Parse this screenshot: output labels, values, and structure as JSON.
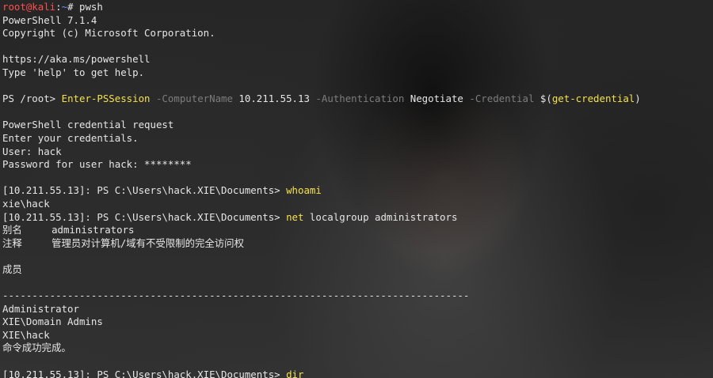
{
  "colors": {
    "text": "#e6e6e6",
    "prompt_user": "#ff4f4f",
    "prompt_path": "#6e8cff",
    "command": "#f5e14f",
    "parameter": "#7d7d7d"
  },
  "terminal": {
    "lines": [
      [
        {
          "t": "root@kali",
          "c": "red"
        },
        {
          "t": ":",
          "c": "white"
        },
        {
          "t": "~",
          "c": "blue"
        },
        {
          "t": "# pwsh",
          "c": "white"
        }
      ],
      [
        {
          "t": "PowerShell 7.1.4",
          "c": "white"
        }
      ],
      [
        {
          "t": "Copyright (c) Microsoft Corporation.",
          "c": "white"
        }
      ],
      [],
      [
        {
          "t": "https://aka.ms/powershell",
          "c": "white"
        }
      ],
      [
        {
          "t": "Type 'help' to get help.",
          "c": "white"
        }
      ],
      [],
      [
        {
          "t": "PS /root> ",
          "c": "white"
        },
        {
          "t": "Enter-PSSession",
          "c": "yellow"
        },
        {
          "t": " -ComputerName",
          "c": "dim"
        },
        {
          "t": " 10.211.55.13",
          "c": "white"
        },
        {
          "t": " -Authentication",
          "c": "dim"
        },
        {
          "t": " Negotiate",
          "c": "white"
        },
        {
          "t": " -Credential",
          "c": "dim"
        },
        {
          "t": " $(",
          "c": "white"
        },
        {
          "t": "get-credential",
          "c": "yellow"
        },
        {
          "t": ")",
          "c": "white"
        }
      ],
      [],
      [
        {
          "t": "PowerShell credential request",
          "c": "white"
        }
      ],
      [
        {
          "t": "Enter your credentials.",
          "c": "white"
        }
      ],
      [
        {
          "t": "User: hack",
          "c": "white"
        }
      ],
      [
        {
          "t": "Password for user hack: ********",
          "c": "white"
        }
      ],
      [],
      [
        {
          "t": "[10.211.55.13]: PS C:\\Users\\hack.XIE\\Documents> ",
          "c": "white"
        },
        {
          "t": "whoami",
          "c": "yellow"
        }
      ],
      [
        {
          "t": "xie\\hack",
          "c": "white"
        }
      ],
      [
        {
          "t": "[10.211.55.13]: PS C:\\Users\\hack.XIE\\Documents> ",
          "c": "white"
        },
        {
          "t": "net",
          "c": "yellow"
        },
        {
          "t": " localgroup administrators",
          "c": "white"
        }
      ],
      [
        {
          "t": "别名     administrators",
          "c": "white"
        }
      ],
      [
        {
          "t": "注释     管理员对计算机/域有不受限制的完全访问权",
          "c": "white"
        }
      ],
      [],
      [
        {
          "t": "成员",
          "c": "white"
        }
      ],
      [],
      [
        {
          "t": "-------------------------------------------------------------------------------",
          "c": "white"
        }
      ],
      [
        {
          "t": "Administrator",
          "c": "white"
        }
      ],
      [
        {
          "t": "XIE\\Domain Admins",
          "c": "white"
        }
      ],
      [
        {
          "t": "XIE\\hack",
          "c": "white"
        }
      ],
      [
        {
          "t": "命令成功完成。",
          "c": "white"
        }
      ],
      [],
      [
        {
          "t": "[10.211.55.13]: PS C:\\Users\\hack.XIE\\Documents> ",
          "c": "white"
        },
        {
          "t": "dir",
          "c": "yellow"
        }
      ]
    ]
  }
}
